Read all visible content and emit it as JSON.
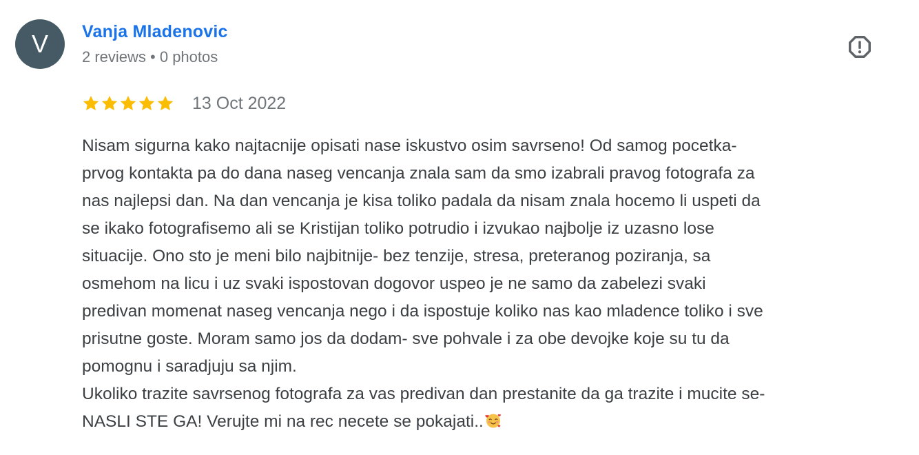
{
  "author": {
    "initial": "V",
    "avatar_color": "#455a64",
    "name": "Vanja Mladenovic",
    "meta": "2 reviews • 0 photos"
  },
  "actions": {
    "report_icon": "report-flag-icon"
  },
  "review": {
    "rating": 5,
    "rating_max": 5,
    "star_color": "#fbbc04",
    "date": "13 Oct 2022",
    "paragraphs": [
      "Nisam sigurna kako najtacnije opisati nase iskustvo osim savrseno! Od samog pocetka-\nprvog kontakta pa do dana naseg vencanja znala sam da smo izabrali pravog fotografa za\nnas najlepsi dan. Na dan vencanja je kisa toliko padala da nisam znala hocemo li uspeti da\nse ikako fotografisemo ali se Kristijan toliko potrudio i izvukao najbolje iz uzasno lose\nsituacije. Ono sto je meni bilo najbitnije- bez tenzije, stresa, preteranog poziranja, sa\nosmehom na licu i uz svaki ispostovan dogovor uspeo je ne samo da zabelezi svaki\npredivan momenat naseg vencanja nego i da ispostuje koliko nas kao mladence toliko i sve\nprisutne goste. Moram samo jos da dodam- sve pohvale i za obe devojke koje su tu da\npomognu i saradjuju sa njim.",
      "Ukoliko trazite savrsenog fotografa za vas predivan dan prestanite da ga trazite i mucite se-\nNASLI STE GA! Verujte mi na rec necete se pokajati.."
    ],
    "trailing_emoji": "smiling-face-with-hearts-icon"
  },
  "colors": {
    "name_link": "#1a73e8",
    "meta_text": "#70757a",
    "body_text": "#3c4043"
  }
}
